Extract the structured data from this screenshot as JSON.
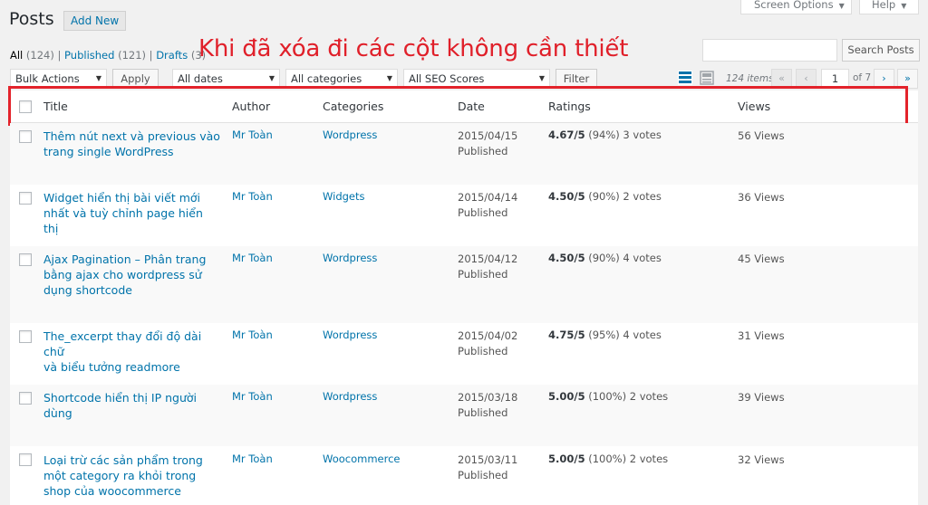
{
  "header": {
    "title": "Posts",
    "add_new": "Add New",
    "screen_options": "Screen Options",
    "help": "Help"
  },
  "filters": {
    "all": "All",
    "all_count": "(124)",
    "published": "Published",
    "published_count": "(121)",
    "drafts": "Drafts",
    "drafts_count": "(3)",
    "sep": "|"
  },
  "annotation": "Khi đã xóa đi các cột không cần thiết",
  "search": {
    "button": "Search Posts",
    "placeholder": ""
  },
  "toolbar": {
    "bulk_actions": "Bulk Actions",
    "apply": "Apply",
    "dates": "All dates",
    "categories": "All categories",
    "seo": "All SEO Scores",
    "filter": "Filter"
  },
  "pagination": {
    "items": "124 items",
    "first": "«",
    "prev": "‹",
    "current": "1",
    "of": "of 7",
    "next": "›",
    "last": "»"
  },
  "columns": {
    "title": "Title",
    "author": "Author",
    "categories": "Categories",
    "date": "Date",
    "ratings": "Ratings",
    "views": "Views"
  },
  "rows": [
    {
      "title_1": "Thêm nút next và previous vào",
      "title_2": "trang single WordPress",
      "title_3": "",
      "author": "Mr Toàn",
      "category": "Wordpress",
      "date": "2015/04/15",
      "status": "Published",
      "rating_score": "4.67/5",
      "rating_rest": "(94%) 3 votes",
      "views": "56 Views"
    },
    {
      "title_1": "Widget hiển thị bài viết mới",
      "title_2": "nhất và tuỳ chỉnh page hiển thị",
      "title_3": "",
      "author": "Mr Toàn",
      "category": "Widgets",
      "date": "2015/04/14",
      "status": "Published",
      "rating_score": "4.50/5",
      "rating_rest": "(90%) 2 votes",
      "views": "36 Views"
    },
    {
      "title_1": "Ajax Pagination – Phân trang",
      "title_2": "bằng ajax cho wordpress sử",
      "title_3": "dụng shortcode",
      "author": "Mr Toàn",
      "category": "Wordpress",
      "date": "2015/04/12",
      "status": "Published",
      "rating_score": "4.50/5",
      "rating_rest": "(90%) 4 votes",
      "views": "45 Views"
    },
    {
      "title_1": "The_excerpt thay đổi độ dài chữ",
      "title_2": "và biểu tưởng readmore",
      "title_3": "",
      "author": "Mr Toàn",
      "category": "Wordpress",
      "date": "2015/04/02",
      "status": "Published",
      "rating_score": "4.75/5",
      "rating_rest": "(95%) 4 votes",
      "views": "31 Views"
    },
    {
      "title_1": "Shortcode hiển thị IP người",
      "title_2": "dùng",
      "title_3": "",
      "author": "Mr Toàn",
      "category": "Wordpress",
      "date": "2015/03/18",
      "status": "Published",
      "rating_score": "5.00/5",
      "rating_rest": "(100%) 2 votes",
      "views": "39 Views"
    },
    {
      "title_1": "Loại trừ các sản phẩm trong",
      "title_2": "một category ra khỏi trong",
      "title_3": "shop của woocommerce",
      "author": "Mr Toàn",
      "category": "Woocommerce",
      "date": "2015/03/11",
      "status": "Published",
      "rating_score": "5.00/5",
      "rating_rest": "(100%) 2 votes",
      "views": "32 Views"
    }
  ],
  "colors": {
    "accent": "#0073aa",
    "annotation": "#e3232b"
  }
}
